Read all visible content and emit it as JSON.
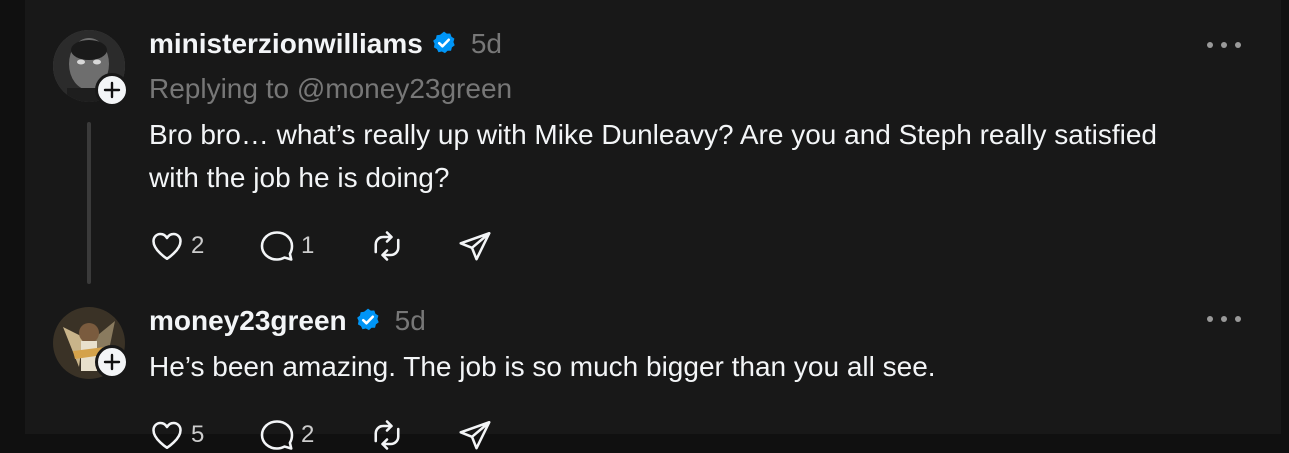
{
  "posts": [
    {
      "username": "ministerzionwilliams",
      "verified": true,
      "time": "5d",
      "replying_to": "Replying to @money23green",
      "text": "Bro bro… what’s really up with Mike Dunleavy? Are you and Steph really satisfied with the job he is doing?",
      "likes": "2",
      "replies": "1"
    },
    {
      "username": "money23green",
      "verified": true,
      "time": "5d",
      "text": "He’s been amazing. The job is so much bigger than you all see.",
      "likes": "5",
      "replies": "2"
    }
  ],
  "colors": {
    "background": "#101010",
    "panel": "#181818",
    "text": "#f3f5f7",
    "muted": "#777777",
    "verified": "#0095f6"
  },
  "icons": [
    "heart-icon",
    "comment-icon",
    "repost-icon",
    "share-icon",
    "more-icon",
    "plus-icon",
    "verified-icon"
  ]
}
